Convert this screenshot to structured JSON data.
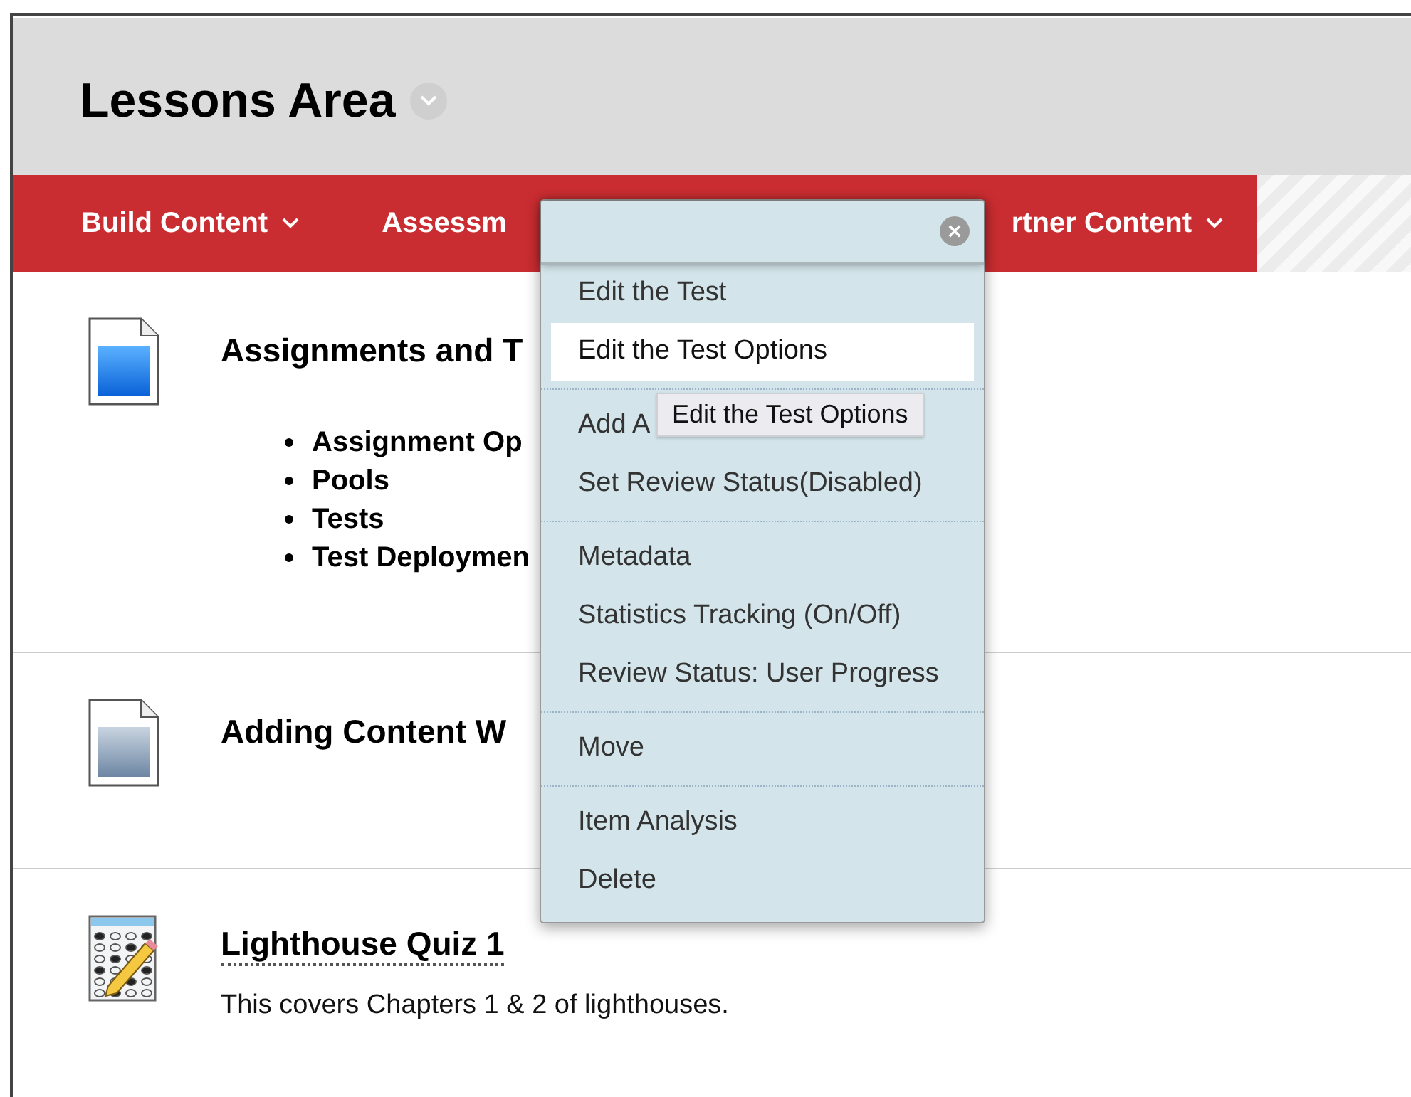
{
  "page_title": "Lessons Area",
  "nav": [
    {
      "label": "Build Content",
      "caret": true
    },
    {
      "label": "Assessm",
      "caret": false
    },
    {
      "label": "rtner Content",
      "caret": true
    }
  ],
  "items": [
    {
      "kind": "document",
      "title": "Assignments and T",
      "link": false,
      "bullets": [
        "Assignment Op",
        "Pools",
        "Tests",
        "Test Deploymen"
      ]
    },
    {
      "kind": "document-plain",
      "title": "Adding Content W",
      "link": false
    },
    {
      "kind": "test",
      "title": "Lighthouse Quiz 1",
      "link": true,
      "description": "This covers Chapters 1 & 2 of lighthouses."
    }
  ],
  "menu": {
    "groups": [
      [
        {
          "label": "Edit the Test",
          "selected": false
        },
        {
          "label": "Edit the Test Options",
          "selected": true
        }
      ],
      [
        {
          "label": "Add A",
          "selected": false
        },
        {
          "label": "Set Review Status(Disabled)",
          "selected": false
        }
      ],
      [
        {
          "label": "Metadata",
          "selected": false
        },
        {
          "label": "Statistics Tracking (On/Off)",
          "selected": false
        },
        {
          "label": "Review Status: User Progress",
          "selected": false
        }
      ],
      [
        {
          "label": "Move",
          "selected": false
        }
      ],
      [
        {
          "label": "Item Analysis",
          "selected": false
        },
        {
          "label": "Delete",
          "selected": false
        }
      ]
    ],
    "tooltip": "Edit the Test Options"
  }
}
